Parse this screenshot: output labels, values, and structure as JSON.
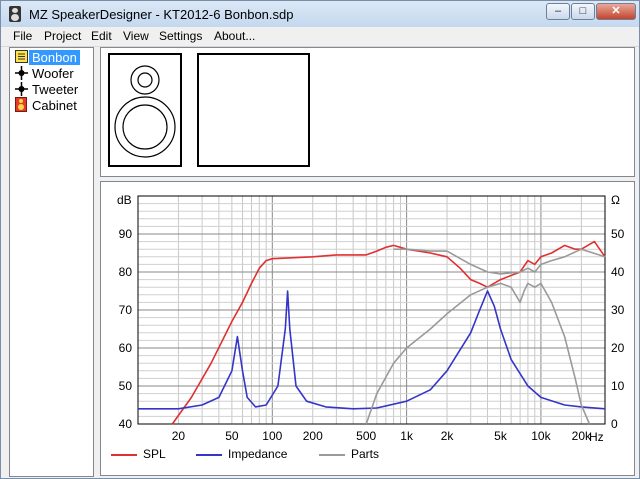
{
  "window": {
    "title": "MZ SpeakerDesigner - KT2012-6 Bonbon.sdp",
    "controls": {
      "minimize": "–",
      "maximize": "□",
      "close": "✕"
    }
  },
  "menu": [
    "File",
    "Project",
    "Edit",
    "View",
    "Settings",
    "About..."
  ],
  "tree": {
    "items": [
      {
        "label": "Bonbon",
        "icon": "project-icon",
        "selected": true
      },
      {
        "label": "Woofer",
        "icon": "driver-icon"
      },
      {
        "label": "Tweeter",
        "icon": "driver-icon"
      },
      {
        "label": "Cabinet",
        "icon": "cabinet-icon"
      }
    ]
  },
  "chart_data": {
    "type": "line",
    "left_axis_label": "dB",
    "right_axis_label": "Ω",
    "x_scale": "log",
    "xlim": [
      10,
      30000
    ],
    "ylim_left": [
      40,
      100
    ],
    "ylim_right": [
      0,
      60
    ],
    "x_tick_labels": [
      {
        "value": 20,
        "label": "20"
      },
      {
        "value": 50,
        "label": "50"
      },
      {
        "value": 100,
        "label": "100"
      },
      {
        "value": 200,
        "label": "200"
      },
      {
        "value": 500,
        "label": "500"
      },
      {
        "value": 1000,
        "label": "1k"
      },
      {
        "value": 2000,
        "label": "2k"
      },
      {
        "value": 5000,
        "label": "5k"
      },
      {
        "value": 10000,
        "label": "10k"
      },
      {
        "value": 20000,
        "label": "20k"
      }
    ],
    "x_unit_label": "Hz",
    "left_tick_labels": [
      "40",
      "50",
      "60",
      "70",
      "80",
      "90"
    ],
    "right_tick_labels": [
      "0",
      "10",
      "20",
      "30",
      "40",
      "50"
    ],
    "grid": true,
    "legend": [
      "SPL",
      "Impedance",
      "Parts"
    ],
    "series": [
      {
        "name": "SPL",
        "axis": "left",
        "color": "#e03030",
        "points": [
          [
            18,
            40
          ],
          [
            25,
            47
          ],
          [
            35,
            56
          ],
          [
            50,
            67
          ],
          [
            60,
            72
          ],
          [
            70,
            77
          ],
          [
            80,
            81
          ],
          [
            90,
            83
          ],
          [
            100,
            83.5
          ],
          [
            200,
            84
          ],
          [
            300,
            84.5
          ],
          [
            500,
            84.5
          ],
          [
            600,
            85.5
          ],
          [
            700,
            86.5
          ],
          [
            800,
            87
          ],
          [
            1000,
            86
          ],
          [
            1500,
            85
          ],
          [
            2000,
            84
          ],
          [
            2500,
            81
          ],
          [
            3000,
            78
          ],
          [
            3500,
            77
          ],
          [
            4000,
            76
          ],
          [
            5000,
            78
          ],
          [
            7000,
            80
          ],
          [
            8000,
            83
          ],
          [
            9000,
            82
          ],
          [
            10000,
            84
          ],
          [
            12000,
            85
          ],
          [
            15000,
            87
          ],
          [
            18000,
            86
          ],
          [
            20000,
            86
          ],
          [
            25000,
            88
          ],
          [
            30000,
            84
          ]
        ]
      },
      {
        "name": "Impedance",
        "axis": "right",
        "color": "#3535c8",
        "points": [
          [
            10,
            4
          ],
          [
            20,
            4
          ],
          [
            30,
            5
          ],
          [
            40,
            7
          ],
          [
            50,
            14
          ],
          [
            55,
            23
          ],
          [
            60,
            14
          ],
          [
            65,
            7
          ],
          [
            75,
            4.5
          ],
          [
            90,
            5
          ],
          [
            110,
            10
          ],
          [
            125,
            25
          ],
          [
            130,
            35
          ],
          [
            135,
            25
          ],
          [
            150,
            10
          ],
          [
            180,
            6
          ],
          [
            250,
            4.5
          ],
          [
            400,
            4
          ],
          [
            600,
            4.2
          ],
          [
            1000,
            6
          ],
          [
            1500,
            9
          ],
          [
            2000,
            14
          ],
          [
            3000,
            24
          ],
          [
            3500,
            30
          ],
          [
            4000,
            35
          ],
          [
            4500,
            31
          ],
          [
            5000,
            25
          ],
          [
            6000,
            17
          ],
          [
            8000,
            10
          ],
          [
            10000,
            7
          ],
          [
            15000,
            5
          ],
          [
            20000,
            4.5
          ],
          [
            30000,
            4
          ]
        ]
      },
      {
        "name": "Parts",
        "axis": "left",
        "color": "#9a9a9a",
        "points": [
          [
            500,
            40
          ],
          [
            600,
            48
          ],
          [
            800,
            56
          ],
          [
            1000,
            60
          ],
          [
            1500,
            65
          ],
          [
            2000,
            69
          ],
          [
            3000,
            74
          ],
          [
            4000,
            76
          ],
          [
            5000,
            77
          ],
          [
            6000,
            76
          ],
          [
            7000,
            72
          ],
          [
            7500,
            75
          ],
          [
            8000,
            77
          ],
          [
            9000,
            76
          ],
          [
            10000,
            77
          ],
          [
            12000,
            72
          ],
          [
            15000,
            63
          ],
          [
            18000,
            52
          ],
          [
            20000,
            45
          ],
          [
            23000,
            40
          ]
        ]
      },
      {
        "name": "Parts",
        "axis": "left",
        "color": "#9a9a9a",
        "points": [
          [
            800,
            86
          ],
          [
            1000,
            86
          ],
          [
            1500,
            85.5
          ],
          [
            2000,
            85.5
          ],
          [
            3000,
            82
          ],
          [
            4000,
            80
          ],
          [
            5000,
            79.5
          ],
          [
            7000,
            80
          ],
          [
            8000,
            81
          ],
          [
            9000,
            80
          ],
          [
            10000,
            82
          ],
          [
            12000,
            83
          ],
          [
            15000,
            84
          ],
          [
            20000,
            86
          ],
          [
            30000,
            84
          ]
        ]
      }
    ]
  }
}
